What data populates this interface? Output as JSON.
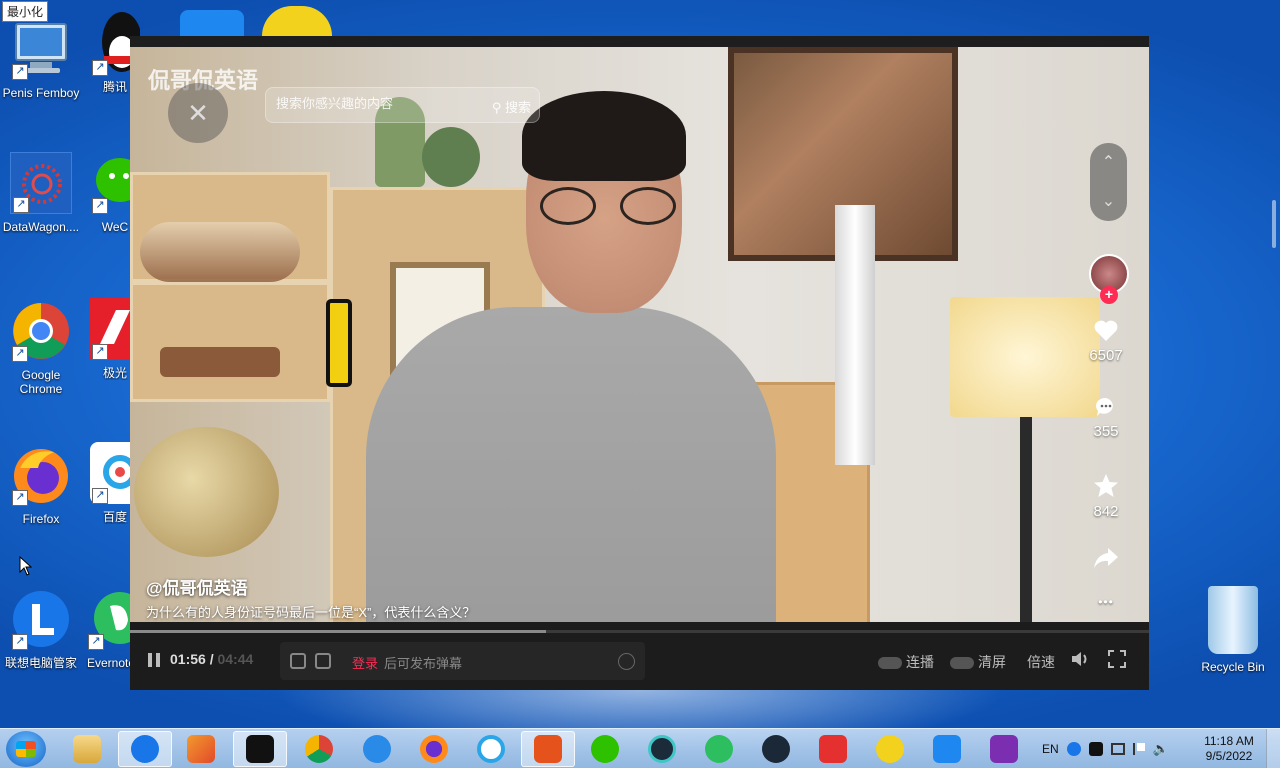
{
  "tooltip": "最小化",
  "desktop_icons": [
    {
      "label": "Penis Femboy",
      "icon": "computer-icon"
    },
    {
      "label": "腾讯",
      "icon": "qq-penguin-icon"
    },
    {
      "label": "DataWagon....",
      "icon": "datawagon-icon"
    },
    {
      "label": "WeC",
      "icon": "wechat-icon"
    },
    {
      "label": "Google Chrome",
      "icon": "chrome-icon"
    },
    {
      "label": "极光",
      "icon": "jiguang-icon"
    },
    {
      "label": "Firefox",
      "icon": "firefox-icon"
    },
    {
      "label": "百度",
      "icon": "baidu-netdisk-icon"
    },
    {
      "label": "联想电脑管家",
      "icon": "lenovo-manager-icon"
    },
    {
      "label": "Evernote",
      "icon": "evernote-icon"
    }
  ],
  "recycle_bin": {
    "label": "Recycle Bin"
  },
  "player": {
    "brand": "侃哥侃英语",
    "search_placeholder": "搜索你感兴趣的内容",
    "search_button": "搜索",
    "close_glyph": "✕",
    "nav_up": "⌃",
    "nav_down": "⌄",
    "likes": "6507",
    "comments": "355",
    "favorites": "842",
    "more": "•••",
    "author": "@侃哥侃英语",
    "description": "为什么有的人身份证号码最后一位是“X”，代表什么含义？",
    "current_time": "01:56",
    "time_separator": "/",
    "total_time": "04:44",
    "progress": 0.408,
    "danmu_login": "登录",
    "danmu_prompt": "后可发布弹幕",
    "autoplay_label": "连播",
    "clear_label": "清屏",
    "speed_label": "倍速"
  },
  "taskbar": {
    "items": [
      "file-explorer-icon",
      "lenovo-icon",
      "media-player-icon",
      "tiktok-icon",
      "chrome-icon",
      "ie-icon",
      "firefox-icon",
      "baidu-netdisk-icon",
      "office-icon",
      "wechat-icon",
      "network-icon",
      "evernote-icon",
      "steam-icon",
      "pdf-icon",
      "qq-music-icon",
      "feishu-icon",
      "onenote-icon"
    ],
    "lang": "EN",
    "time": "11:18 AM",
    "date": "9/5/2022"
  },
  "colors": {
    "accent": "#fe2c55",
    "tab_yellow": "#f3cf12"
  }
}
